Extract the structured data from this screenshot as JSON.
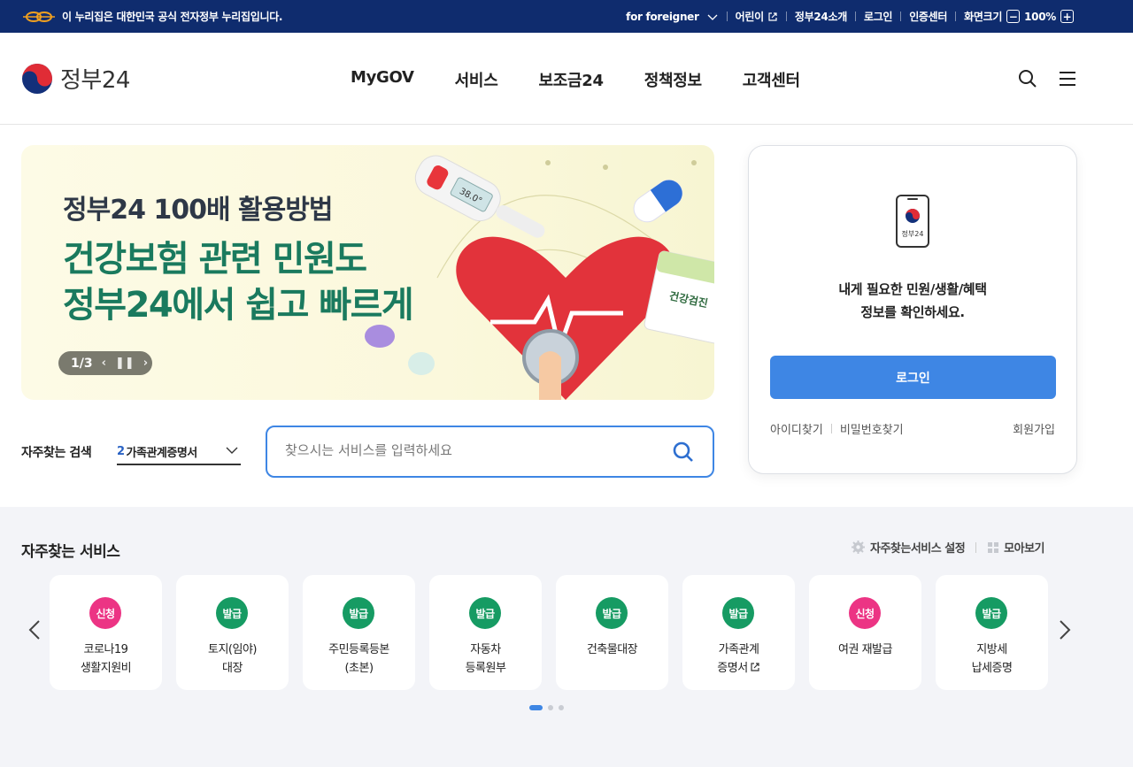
{
  "topbar": {
    "notice": "이 누리집은 대한민국 공식 전자정부 누리집입니다.",
    "links": [
      "for foreigner",
      "어린이",
      "정부24소개",
      "로그인",
      "인증센터"
    ],
    "zoom_label": "화면크기",
    "zoom_value": "100%",
    "zoom_minus": "−",
    "zoom_plus": "+"
  },
  "header": {
    "brand": "정부24",
    "nav": [
      "MyGOV",
      "서비스",
      "보조금24",
      "정책정보",
      "고객센터"
    ],
    "icons": [
      "search-icon",
      "menu-icon"
    ]
  },
  "banner": {
    "subtitle": "정부24 100배 활용방법",
    "line1": "건강보험 관련 민원도",
    "line2": "정부24에서 쉽고 빠르게",
    "counter": "1/3",
    "thermo": "38.0°",
    "calendar": "건강검진"
  },
  "login": {
    "icon_label": "정부24",
    "msg_line1": "내게 필요한 민원/생활/혜택",
    "msg_line2": "정보를 확인하세요.",
    "button": "로그인",
    "find_id": "아이디찾기",
    "find_pw": "비밀번호찾기",
    "signup": "회원가입"
  },
  "search": {
    "label": "자주찾는 검색",
    "selected_num": "2",
    "selected": "가족관계증명서",
    "placeholder": "찾으시는 서비스를 입력하세요"
  },
  "services": {
    "title": "자주찾는 서비스",
    "settings": "자주찾는서비스 설정",
    "view_all": "모아보기",
    "items": [
      {
        "badge": "신청",
        "type": "apply",
        "line1": "코로나19",
        "line2": "생활지원비"
      },
      {
        "badge": "발급",
        "type": "issue",
        "line1": "토지(임야)",
        "line2": "대장"
      },
      {
        "badge": "발급",
        "type": "issue",
        "line1": "주민등록등본",
        "line2": "(초본)"
      },
      {
        "badge": "발급",
        "type": "issue",
        "line1": "자동차",
        "line2": "등록원부"
      },
      {
        "badge": "발급",
        "type": "issue",
        "line1": "건축물대장",
        "line2": ""
      },
      {
        "badge": "발급",
        "type": "issue",
        "line1": "가족관계",
        "line2": "증명서"
      },
      {
        "badge": "신청",
        "type": "apply",
        "line1": "여권 재발급",
        "line2": ""
      },
      {
        "badge": "발급",
        "type": "issue",
        "line1": "지방세",
        "line2": "납세증명"
      }
    ]
  },
  "colors": {
    "topbar": "#0f2c6e",
    "accent": "#3e86e4",
    "apply": "#ec3484",
    "issue": "#169b63",
    "banner_green": "#1a7a5e"
  }
}
